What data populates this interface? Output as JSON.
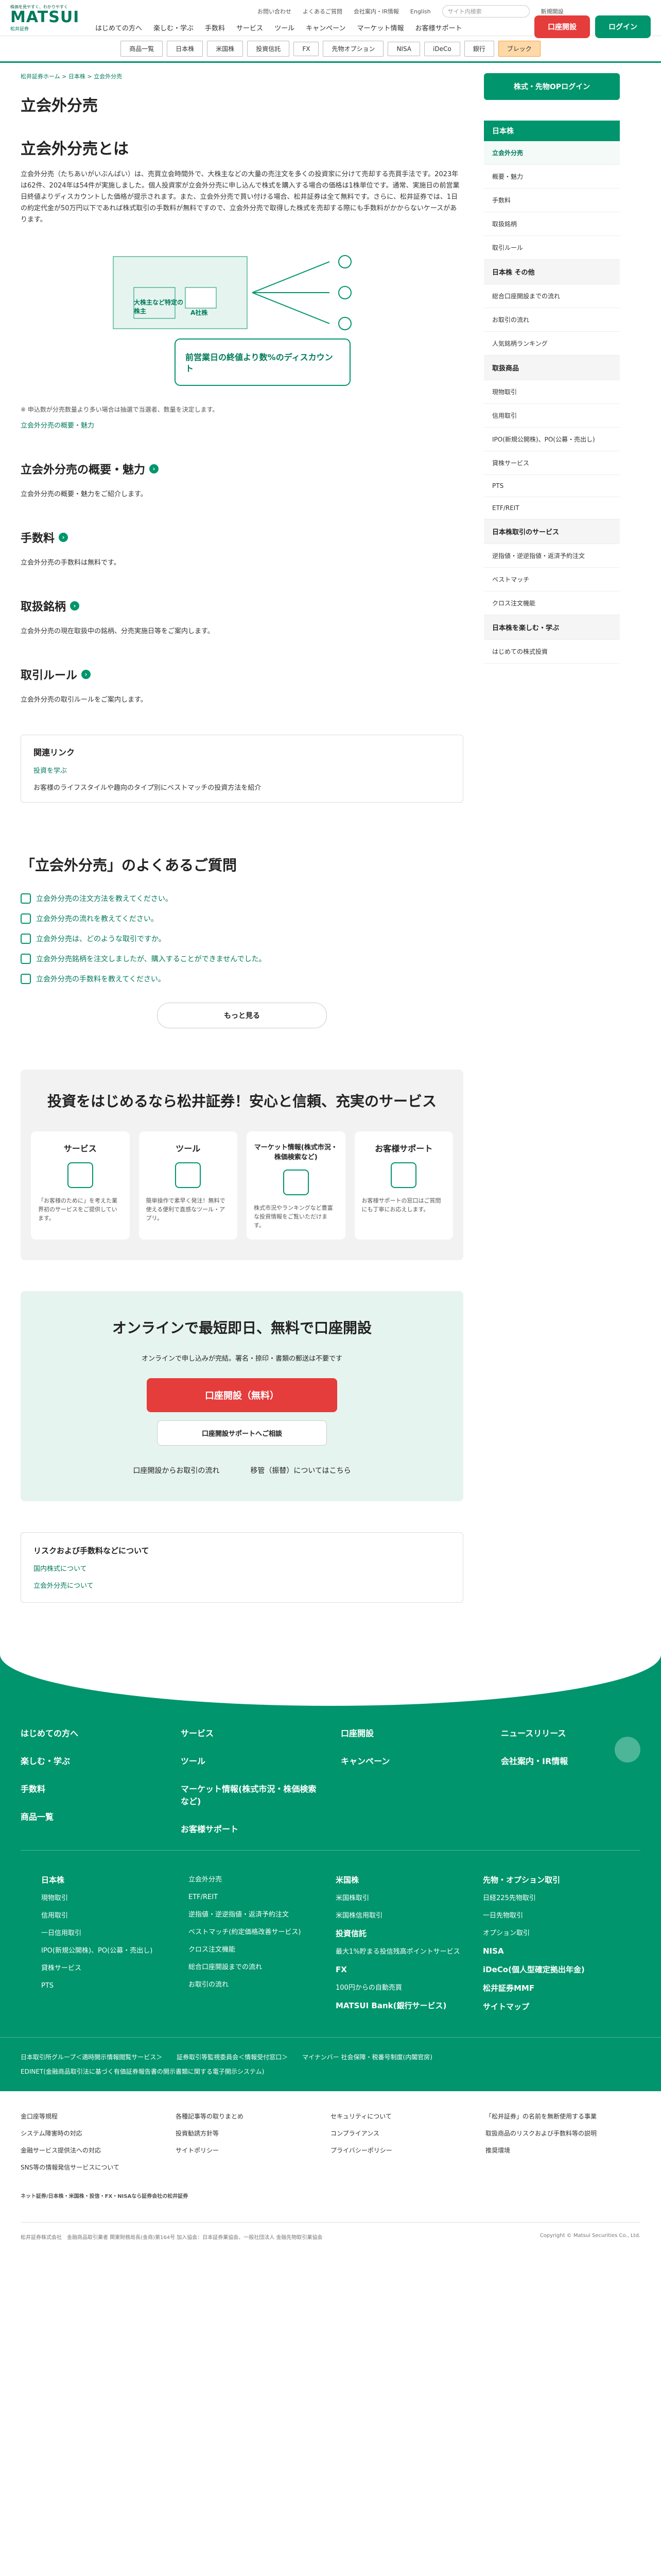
{
  "header": {
    "tagline": "株価を見やすく、わかりやすく",
    "brand": "MATSUI",
    "brand_sub": "松井証券",
    "util": [
      "お問い合わせ",
      "よくあるご質問",
      "会社案内・IR情報",
      "English"
    ],
    "search_placeholder": "サイト内検索",
    "menu": "新規開設",
    "nav": [
      "はじめての方へ",
      "楽しむ・学ぶ",
      "手数料",
      "サービス",
      "ツール",
      "キャンペーン",
      "マーケット情報",
      "お客様サポート"
    ],
    "open_btn": "口座開設",
    "login_btn": "ログイン"
  },
  "subnav": [
    "商品一覧",
    "日本株",
    "米国株",
    "投資信託",
    "FX",
    "先物オプション",
    "NISA",
    "iDeCo",
    "銀行",
    "ブレック"
  ],
  "crumb": "松井証券ホーム > 日本株 > 立会外分売",
  "page": {
    "title": "立会外分売",
    "h2": "立会外分売とは",
    "lead": "立会外分売（たちあいがいぶんばい）は、売買立会時間外で、大株主などの大量の売注文を多くの投資家に分けて売却する売買手法です。2023年は62件、2024年は54件が実施しました。個人投資家が立会外分売に申し込んで株式を購入する場合の価格は1株単位です。通常、実施日の前営業日終値よりディスカウントした価格が提示されます。また、立会外分売で買い付ける場合、松井証券は全て無料です。さらに、松井証券では、1日の約定代金が50万円以下であれば株式取引の手数料が無料ですので、立会外分売で取得した株式を売却する際にも手数料がかからないケースがあります。",
    "illus_left": "大株主など特定の株主",
    "illus_mid": "A社株",
    "illus_bottom": "前営業日の終値より数%のディスカウント",
    "note": "※ 申込数が分売数量より多い場合は抽選で当選者、数量を決定します。",
    "summary_link": "立会外分売の概要・魅力"
  },
  "sections": [
    {
      "h": "立会外分売の概要・魅力",
      "p": "立会外分売の概要・魅力をご紹介します。"
    },
    {
      "h": "手数料",
      "p": "立会外分売の手数料は無料です。"
    },
    {
      "h": "取扱銘柄",
      "p": "立会外分売の現在取扱中の銘柄、分売実施日等をご案内します。"
    },
    {
      "h": "取引ルール",
      "p": "立会外分売の取引ルールをご案内します。"
    }
  ],
  "related": {
    "h": "関連リンク",
    "a": "投資を学ぶ",
    "b": "お客様のライフスタイルや趣向のタイプ別にベストマッチの投資方法を紹介"
  },
  "faq": {
    "h": "「立会外分売」のよくあるご質問",
    "items": [
      "立会外分売の注文方法を教えてください。",
      "立会外分売の流れを教えてください。",
      "立会外分売は、どのような取引ですか。",
      "立会外分売銘柄を注文しましたが、購入することができませんでした。",
      "立会外分売の手数料を教えてください。"
    ],
    "more": "もっと見る"
  },
  "services": {
    "h": "投資をはじめるなら松井証券！安心と信頼、充実のサービス",
    "cards": [
      {
        "t": "サービス",
        "d": "「お客様のために」を考えた業界初のサービスをご提供しています。"
      },
      {
        "t": "ツール",
        "d": "簡単操作で素早く発注！無料で使える便利で直感なツール・アプリ。"
      },
      {
        "t": "マーケット情報(株式市況・株価検索など)",
        "d": "株式市況やランキングなど豊富な投資情報をご覧いただけます。"
      },
      {
        "t": "お客様サポート",
        "d": "お客様サポートの窓口はご質問にも丁寧にお応えします。"
      }
    ]
  },
  "open": {
    "h": "オンラインで最短即日、無料で口座開設",
    "sub": "オンラインで申し込みが完結。署名・捺印・書類の郵送は不要です",
    "big": "口座開設（無料）",
    "sm": "口座開設サポートへご相談",
    "l1": "口座開設からお取引の流れ",
    "l2": "移管（振替）についてはこちら"
  },
  "risk": {
    "h": "リスクおよび手数料などについて",
    "a": "国内株式について",
    "b": "立会外分売について"
  },
  "side": {
    "login": "株式・先物OPログイン",
    "head": "日本株",
    "items": [
      "立会外分売",
      "概要・魅力",
      "手数料",
      "取扱銘柄",
      "取引ルール"
    ],
    "other": "日本株 その他",
    "o": [
      "総合口座開設までの流れ",
      "お取引の流れ",
      "人気銘柄ランキング"
    ],
    "s2": "取扱商品",
    "o2": [
      "現物取引",
      "信用取引",
      "IPO(新規公開株)、PO(公募・売出し)",
      "貸株サービス",
      "PTS",
      "ETF/REIT"
    ],
    "s3": "日本株取引のサービス",
    "o3": [
      "逆指値・逆逆指値・返済予約注文",
      "ベストマッチ",
      "クロス注文機能"
    ],
    "s4": "日本株を楽しむ・学ぶ",
    "o4": [
      "はじめての株式投資"
    ]
  },
  "footer": {
    "top": [
      "はじめての方へ",
      "楽しむ・学ぶ",
      "手数料",
      "商品一覧",
      "サービス",
      "ツール",
      "マーケット情報(株式市況・株価検索など)",
      "お客様サポート",
      "口座開設",
      "キャンペーン",
      "ニュースリリース",
      "会社案内・IR情報"
    ],
    "c1": [
      "日本株",
      "現物取引",
      "信用取引",
      "一日信用取引",
      "IPO(新規公開株)、PO(公募・売出し)",
      "貸株サービス",
      "PTS"
    ],
    "c2": [
      "立会外分売",
      "ETF/REIT",
      "逆指値・逆逆指値・返済予約注文",
      "ベストマッチ(約定価格改善サービス)",
      "クロス注文機能",
      "総合口座開設までの流れ",
      "お取引の流れ"
    ],
    "c3": [
      "米国株",
      "米国株取引",
      "米国株信用取引",
      "投資信託",
      "最大1%貯まる投信残高ポイントサービス",
      "FX",
      "100円からの自動売買",
      "MATSUI Bank(銀行サービス)"
    ],
    "c4": [
      "先物・オプション取引",
      "日経225先物取引",
      "一日先物取引",
      "オプション取引",
      "NISA",
      "iDeCo(個人型確定拠出年金)",
      "松井証券MMF",
      "サイトマップ"
    ],
    "bar": [
      "日本取引所グループ＜適時開示情報閲覧サービス＞",
      "証券取引等監視委員会＜情報受付窓口＞",
      "マイナンバー 社会保障・税番号制度(内閣官房)",
      "EDINET(金融商品取引法に基づく有価証券報告書の開示書類に関する電子開示システム)"
    ]
  },
  "bottom": {
    "links": [
      "金口座等規程",
      "各種記事等の取りまとめ",
      "セキュリティについて",
      "「松井証券」の名前を無断使用する事業",
      "システム障害時の対応",
      "投資勧誘方針等",
      "コンプライアンス",
      "取扱商品のリスクおよび手数料等の説明",
      "金融サービス提供法への対応",
      "サイトポリシー",
      "プライバシーポリシー",
      "推奨環境",
      "SNS等の情報発信サービスについて"
    ],
    "legal": "ネット証券/日本株・米国株・投信・FX・NISAなら証券会社の松井証券",
    "company": "松井証券株式会社　金融商品取引業者 関東財務局長(金商)第164号 加入協会：日本証券業協会、一般社団法人 金融先物取引業協会",
    "copy": "Copyright © Matsui Securities Co., Ltd."
  }
}
